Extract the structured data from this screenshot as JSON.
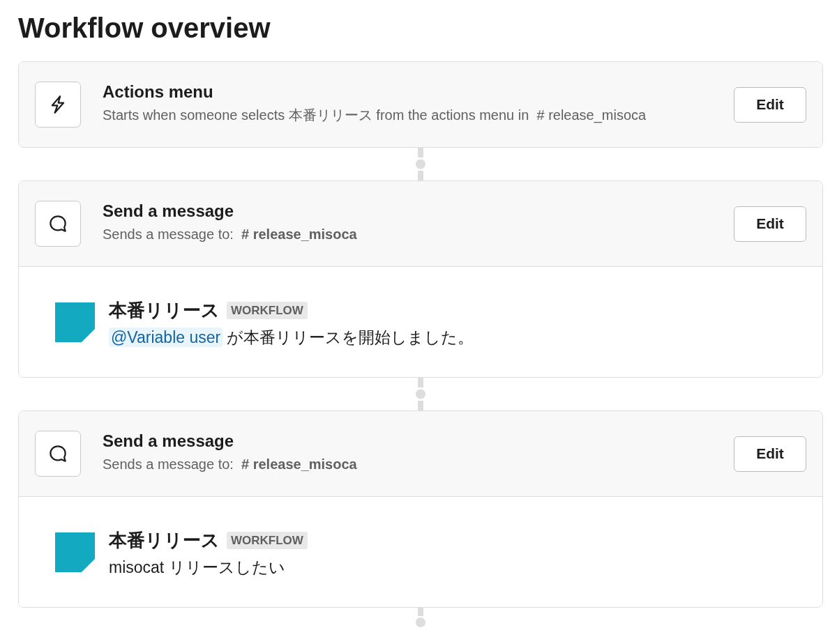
{
  "title": "Workflow overview",
  "steps": [
    {
      "kind": "trigger",
      "title": "Actions menu",
      "description": "Starts when someone selects 本番リリース from the actions menu in  # release_misoca",
      "button": "Edit"
    },
    {
      "kind": "message",
      "title": "Send a message",
      "description": "Sends a message to:  **# release_misoca**",
      "button": "Edit",
      "message": {
        "sender": "本番リリース",
        "badge": "WORKFLOW",
        "parts": [
          {
            "kind": "mention",
            "text": "@Variable user"
          },
          {
            "kind": "text",
            "text": "が本番リリースを開始しました。"
          }
        ]
      }
    },
    {
      "kind": "message",
      "title": "Send a message",
      "description": "Sends a message to:  **# release_misoca**",
      "button": "Edit",
      "message": {
        "sender": "本番リリース",
        "badge": "WORKFLOW",
        "parts": [
          {
            "kind": "text",
            "text": "misocat リリースしたい"
          }
        ]
      }
    }
  ]
}
